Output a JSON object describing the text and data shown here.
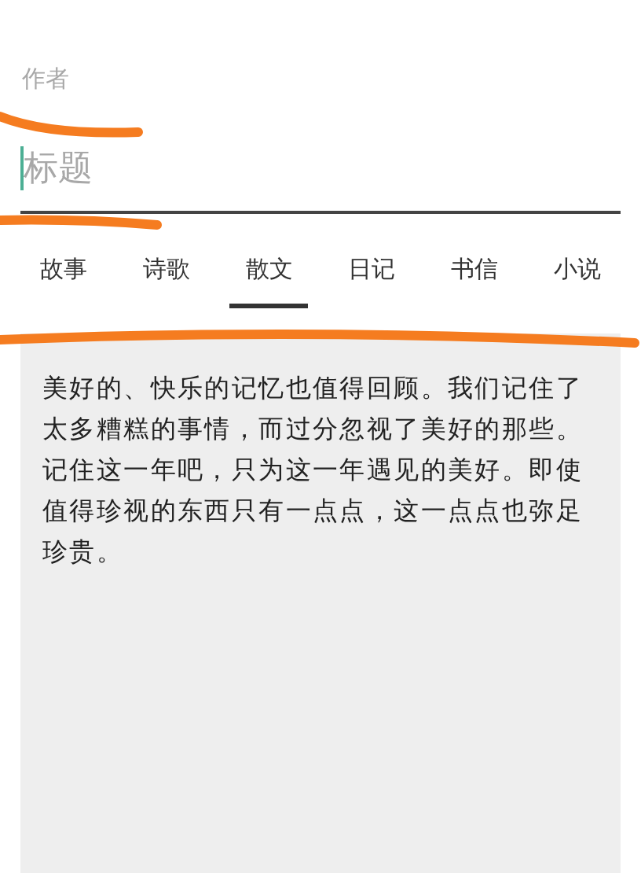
{
  "author_field": {
    "placeholder": "作者"
  },
  "title_field": {
    "placeholder": "标题"
  },
  "tabs": [
    {
      "label": "故事",
      "selected": false
    },
    {
      "label": "诗歌",
      "selected": false
    },
    {
      "label": "散文",
      "selected": true
    },
    {
      "label": "日记",
      "selected": false
    },
    {
      "label": "书信",
      "selected": false
    },
    {
      "label": "小说",
      "selected": false
    }
  ],
  "body_text": "美好的、快乐的记忆也值得回顾。我们记住了太多糟糕的事情，而过分忽视了美好的那些。记住这一年吧，只为这一年遇见的美好。即使值得珍视的东西只有一点点，这一点点也弥足珍贵。"
}
